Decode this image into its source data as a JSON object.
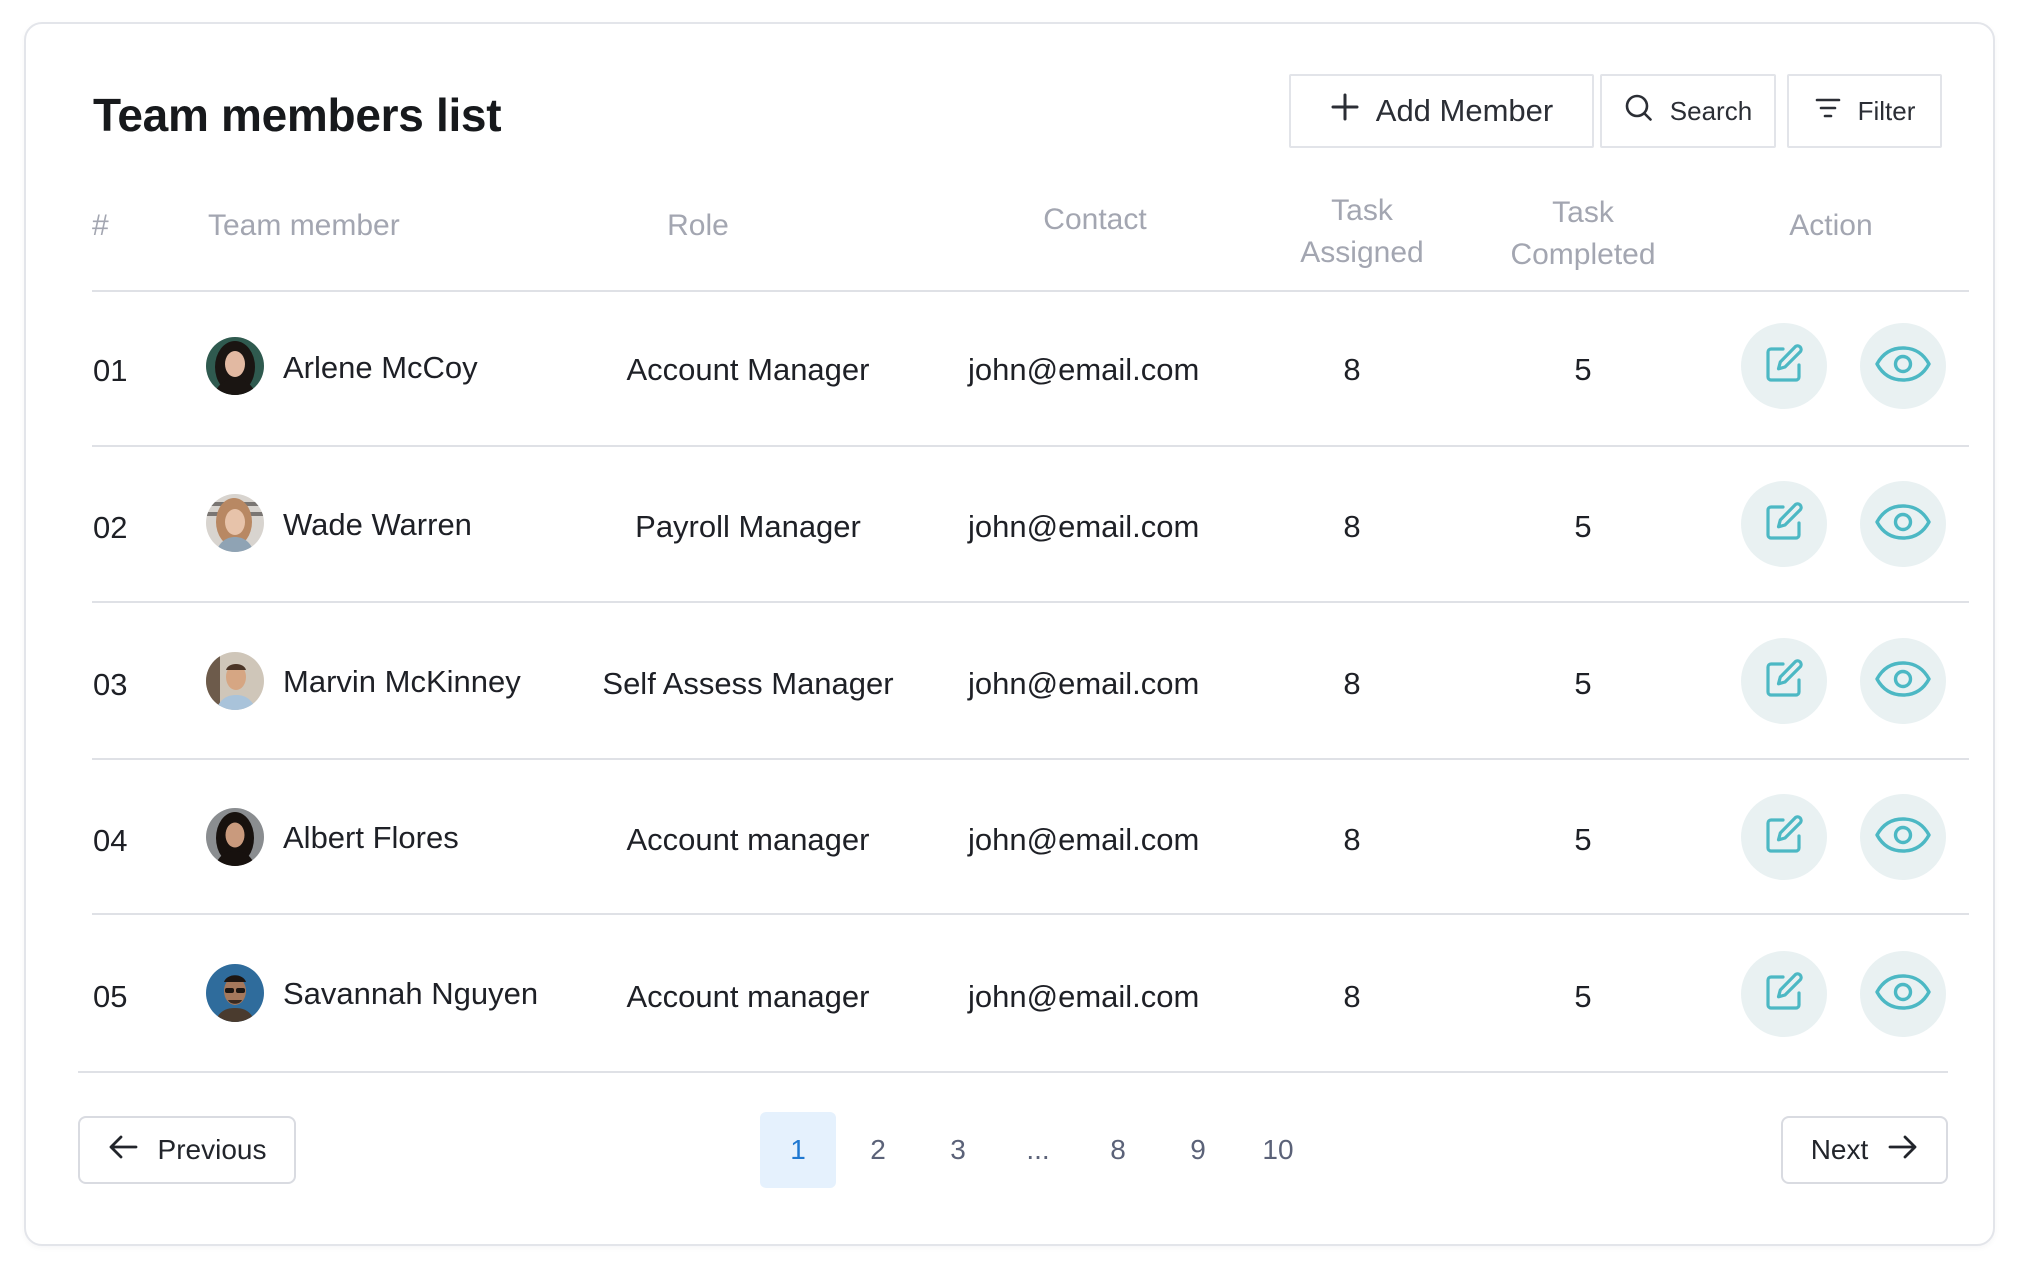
{
  "title": "Team members list",
  "toolbar": {
    "add_label": "Add Member",
    "search_label": "Search",
    "filter_label": "Filter"
  },
  "columns": {
    "num": "#",
    "member": "Team member",
    "role": "Role",
    "contact": "Contact",
    "task_assigned_1": "Task",
    "task_assigned_2": "Assigned",
    "task_completed_1": "Task",
    "task_completed_2": "Completed",
    "action": "Action"
  },
  "rows": [
    {
      "num": "01",
      "name": "Arlene McCoy",
      "role": "Account Manager",
      "email": "john@email.com",
      "assigned": "8",
      "completed": "5"
    },
    {
      "num": "02",
      "name": "Wade Warren",
      "role": "Payroll Manager",
      "email": "john@email.com",
      "assigned": "8",
      "completed": "5"
    },
    {
      "num": "03",
      "name": "Marvin McKinney",
      "role": "Self Assess Manager",
      "email": "john@email.com",
      "assigned": "8",
      "completed": "5"
    },
    {
      "num": "04",
      "name": "Albert Flores",
      "role": "Account manager",
      "email": "john@email.com",
      "assigned": "8",
      "completed": "5"
    },
    {
      "num": "05",
      "name": "Savannah Nguyen",
      "role": "Account manager",
      "email": "john@email.com",
      "assigned": "8",
      "completed": "5"
    }
  ],
  "pagination": {
    "prev_label": "Previous",
    "next_label": "Next",
    "pages": [
      "1",
      "2",
      "3",
      "...",
      "8",
      "9",
      "10"
    ],
    "current": "1"
  },
  "icons": {
    "add": "plus-icon",
    "search": "search-icon",
    "filter": "filter-icon",
    "edit": "edit-icon",
    "view": "eye-icon",
    "prev": "arrow-left-icon",
    "next": "arrow-right-icon"
  },
  "colors": {
    "action_icon": "#4cb8c4",
    "action_bg": "#e9f1f2",
    "active_page_bg": "#e5f1fd",
    "active_page_text": "#1f78d1",
    "header_text": "#a3a6b1"
  }
}
